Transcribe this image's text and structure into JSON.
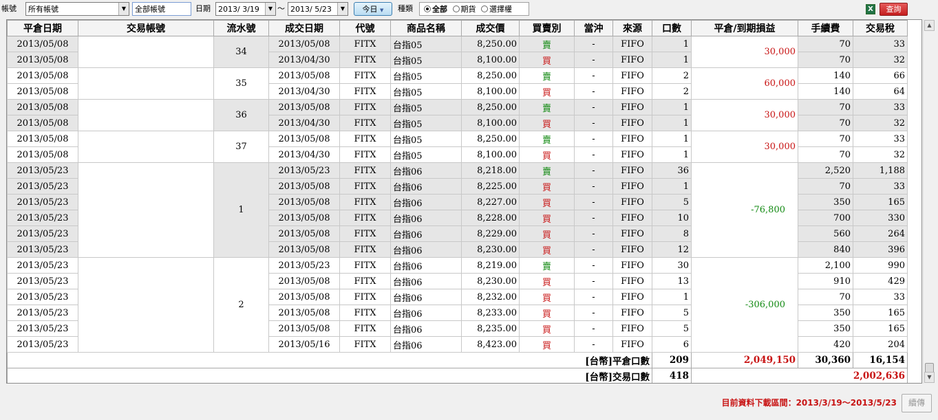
{
  "toolbar": {
    "account_label": "帳號",
    "account_value": "所有帳號",
    "account_name_value": "全部帳號",
    "date_label": "日期",
    "date_from": "2013/ 3/19",
    "tilde": "～",
    "date_to": "2013/ 5/23",
    "today_label": "今日",
    "type_label": "種類",
    "type_options": [
      "全部",
      "期貨",
      "選擇權"
    ],
    "type_selected": "全部",
    "excel_icon": "excel-icon",
    "query_label": "查詢"
  },
  "columns": [
    "平倉日期",
    "交易帳號",
    "流水號",
    "成交日期",
    "代號",
    "商品名稱",
    "成交價",
    "買賣別",
    "當沖",
    "來源",
    "口數",
    "平倉/到期損益",
    "手續費",
    "交易稅"
  ],
  "colors": {
    "buy": "#c81414",
    "sell": "#138a13",
    "grid_shade": "#e6e6e6"
  },
  "groups": [
    {
      "serial": "34",
      "pnl": "30,000",
      "pnl_sign": "pos",
      "shaded": true,
      "rows": [
        {
          "close_date": "2013/05/08",
          "trade_date": "2013/05/08",
          "code": "FITX",
          "product": "台指05",
          "price": "8,250.00",
          "side": "賣",
          "daytrade": "-",
          "source": "FIFO",
          "qty": "1",
          "fee": "70",
          "tax": "33"
        },
        {
          "close_date": "2013/05/08",
          "trade_date": "2013/04/30",
          "code": "FITX",
          "product": "台指05",
          "price": "8,100.00",
          "side": "買",
          "daytrade": "-",
          "source": "FIFO",
          "qty": "1",
          "fee": "70",
          "tax": "32"
        }
      ]
    },
    {
      "serial": "35",
      "pnl": "60,000",
      "pnl_sign": "pos",
      "shaded": false,
      "rows": [
        {
          "close_date": "2013/05/08",
          "trade_date": "2013/05/08",
          "code": "FITX",
          "product": "台指05",
          "price": "8,250.00",
          "side": "賣",
          "daytrade": "-",
          "source": "FIFO",
          "qty": "2",
          "fee": "140",
          "tax": "66"
        },
        {
          "close_date": "2013/05/08",
          "trade_date": "2013/04/30",
          "code": "FITX",
          "product": "台指05",
          "price": "8,100.00",
          "side": "買",
          "daytrade": "-",
          "source": "FIFO",
          "qty": "2",
          "fee": "140",
          "tax": "64"
        }
      ]
    },
    {
      "serial": "36",
      "pnl": "30,000",
      "pnl_sign": "pos",
      "shaded": true,
      "rows": [
        {
          "close_date": "2013/05/08",
          "trade_date": "2013/05/08",
          "code": "FITX",
          "product": "台指05",
          "price": "8,250.00",
          "side": "賣",
          "daytrade": "-",
          "source": "FIFO",
          "qty": "1",
          "fee": "70",
          "tax": "33"
        },
        {
          "close_date": "2013/05/08",
          "trade_date": "2013/04/30",
          "code": "FITX",
          "product": "台指05",
          "price": "8,100.00",
          "side": "買",
          "daytrade": "-",
          "source": "FIFO",
          "qty": "1",
          "fee": "70",
          "tax": "32"
        }
      ]
    },
    {
      "serial": "37",
      "pnl": "30,000",
      "pnl_sign": "pos",
      "shaded": false,
      "rows": [
        {
          "close_date": "2013/05/08",
          "trade_date": "2013/05/08",
          "code": "FITX",
          "product": "台指05",
          "price": "8,250.00",
          "side": "賣",
          "daytrade": "-",
          "source": "FIFO",
          "qty": "1",
          "fee": "70",
          "tax": "33"
        },
        {
          "close_date": "2013/05/08",
          "trade_date": "2013/04/30",
          "code": "FITX",
          "product": "台指05",
          "price": "8,100.00",
          "side": "買",
          "daytrade": "-",
          "source": "FIFO",
          "qty": "1",
          "fee": "70",
          "tax": "32"
        }
      ]
    },
    {
      "serial": "1",
      "pnl": "-76,800",
      "pnl_sign": "neg",
      "shaded": true,
      "rows": [
        {
          "close_date": "2013/05/23",
          "trade_date": "2013/05/23",
          "code": "FITX",
          "product": "台指06",
          "price": "8,218.00",
          "side": "賣",
          "daytrade": "-",
          "source": "FIFO",
          "qty": "36",
          "fee": "2,520",
          "tax": "1,188"
        },
        {
          "close_date": "2013/05/23",
          "trade_date": "2013/05/08",
          "code": "FITX",
          "product": "台指06",
          "price": "8,225.00",
          "side": "買",
          "daytrade": "-",
          "source": "FIFO",
          "qty": "1",
          "fee": "70",
          "tax": "33"
        },
        {
          "close_date": "2013/05/23",
          "trade_date": "2013/05/08",
          "code": "FITX",
          "product": "台指06",
          "price": "8,227.00",
          "side": "買",
          "daytrade": "-",
          "source": "FIFO",
          "qty": "5",
          "fee": "350",
          "tax": "165"
        },
        {
          "close_date": "2013/05/23",
          "trade_date": "2013/05/08",
          "code": "FITX",
          "product": "台指06",
          "price": "8,228.00",
          "side": "買",
          "daytrade": "-",
          "source": "FIFO",
          "qty": "10",
          "fee": "700",
          "tax": "330"
        },
        {
          "close_date": "2013/05/23",
          "trade_date": "2013/05/08",
          "code": "FITX",
          "product": "台指06",
          "price": "8,229.00",
          "side": "買",
          "daytrade": "-",
          "source": "FIFO",
          "qty": "8",
          "fee": "560",
          "tax": "264"
        },
        {
          "close_date": "2013/05/23",
          "trade_date": "2013/05/08",
          "code": "FITX",
          "product": "台指06",
          "price": "8,230.00",
          "side": "買",
          "daytrade": "-",
          "source": "FIFO",
          "qty": "12",
          "fee": "840",
          "tax": "396"
        }
      ]
    },
    {
      "serial": "2",
      "pnl": "-306,000",
      "pnl_sign": "neg",
      "shaded": false,
      "rows": [
        {
          "close_date": "2013/05/23",
          "trade_date": "2013/05/23",
          "code": "FITX",
          "product": "台指06",
          "price": "8,219.00",
          "side": "賣",
          "daytrade": "-",
          "source": "FIFO",
          "qty": "30",
          "fee": "2,100",
          "tax": "990"
        },
        {
          "close_date": "2013/05/23",
          "trade_date": "2013/05/08",
          "code": "FITX",
          "product": "台指06",
          "price": "8,230.00",
          "side": "買",
          "daytrade": "-",
          "source": "FIFO",
          "qty": "13",
          "fee": "910",
          "tax": "429"
        },
        {
          "close_date": "2013/05/23",
          "trade_date": "2013/05/08",
          "code": "FITX",
          "product": "台指06",
          "price": "8,232.00",
          "side": "買",
          "daytrade": "-",
          "source": "FIFO",
          "qty": "1",
          "fee": "70",
          "tax": "33"
        },
        {
          "close_date": "2013/05/23",
          "trade_date": "2013/05/08",
          "code": "FITX",
          "product": "台指06",
          "price": "8,233.00",
          "side": "買",
          "daytrade": "-",
          "source": "FIFO",
          "qty": "5",
          "fee": "350",
          "tax": "165"
        },
        {
          "close_date": "2013/05/23",
          "trade_date": "2013/05/08",
          "code": "FITX",
          "product": "台指06",
          "price": "8,235.00",
          "side": "買",
          "daytrade": "-",
          "source": "FIFO",
          "qty": "5",
          "fee": "350",
          "tax": "165"
        },
        {
          "close_date": "2013/05/23",
          "trade_date": "2013/05/16",
          "code": "FITX",
          "product": "台指06",
          "price": "8,423.00",
          "side": "買",
          "daytrade": "-",
          "source": "FIFO",
          "qty": "6",
          "fee": "420",
          "tax": "204"
        }
      ]
    }
  ],
  "summary": {
    "close_qty_label": "[台幣]平倉口數",
    "close_qty": "209",
    "close_pnl": "2,049,150",
    "close_fee": "30,360",
    "close_tax": "16,154",
    "trade_qty_label": "[台幣]交易口數",
    "trade_qty": "418",
    "trade_net": "2,002,636"
  },
  "footer": {
    "status": "目前資料下載區間：2013/3/19～2013/5/23",
    "continue_label": "續傳"
  }
}
